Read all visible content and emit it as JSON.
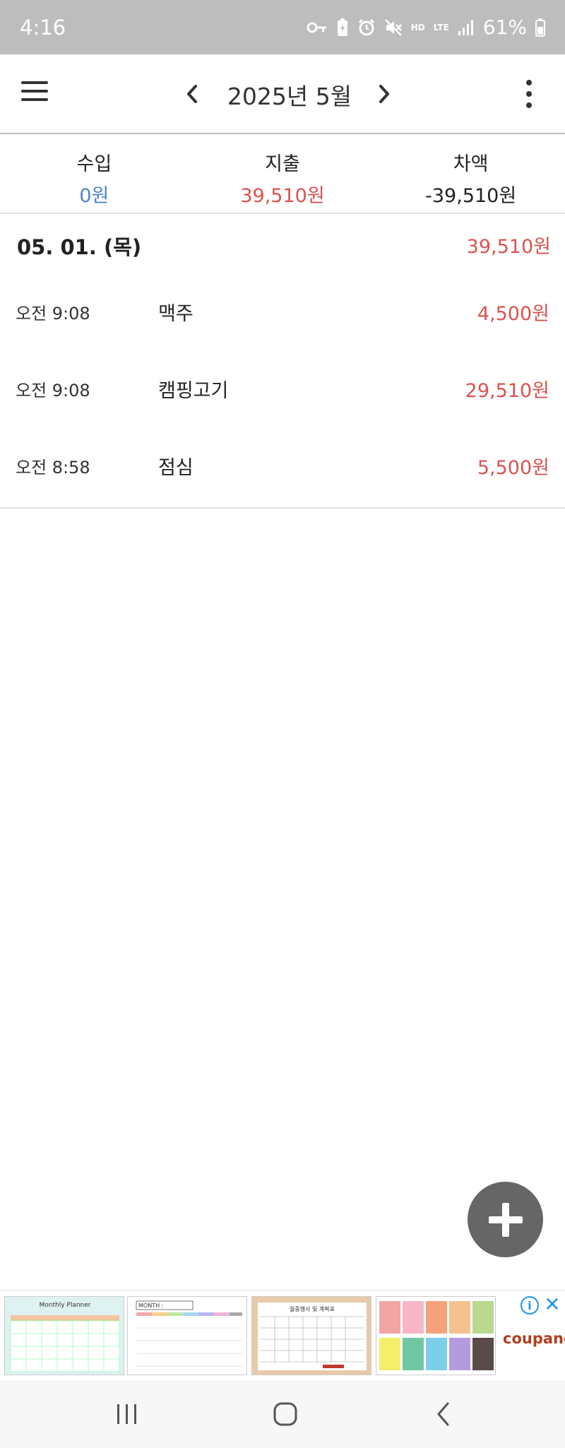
{
  "status_bar": {
    "time": "4:16",
    "battery": "61%",
    "network_hd": "HD",
    "network_lte": "LTE"
  },
  "header": {
    "title": "2025년 5월",
    "menu_icon": "hamburger-menu-icon",
    "prev_icon": "chevron-left-icon",
    "next_icon": "chevron-right-icon",
    "more_icon": "more-vertical-icon"
  },
  "summary": {
    "income_label": "수입",
    "income_value": "0원",
    "expense_label": "지출",
    "expense_value": "39,510원",
    "balance_label": "차액",
    "balance_value": "-39,510원"
  },
  "day": {
    "date": "05. 01. (목)",
    "total": "39,510원",
    "transactions": [
      {
        "time": "오전 9:08",
        "name": "맥주",
        "amount": "4,500원"
      },
      {
        "time": "오전 9:08",
        "name": "캠핑고기",
        "amount": "29,510원"
      },
      {
        "time": "오전 8:58",
        "name": "점심",
        "amount": "5,500원"
      }
    ]
  },
  "ad": {
    "brand": "coupang",
    "thumb1_title": "Monthly Planner",
    "thumb2_title": "MONTH :",
    "thumb3_title": "월중행사 및 계획표"
  },
  "colors": {
    "income": "#4a86c5",
    "expense": "#d9534f",
    "fab": "#666666",
    "status_bar": "#bdbdbd"
  }
}
